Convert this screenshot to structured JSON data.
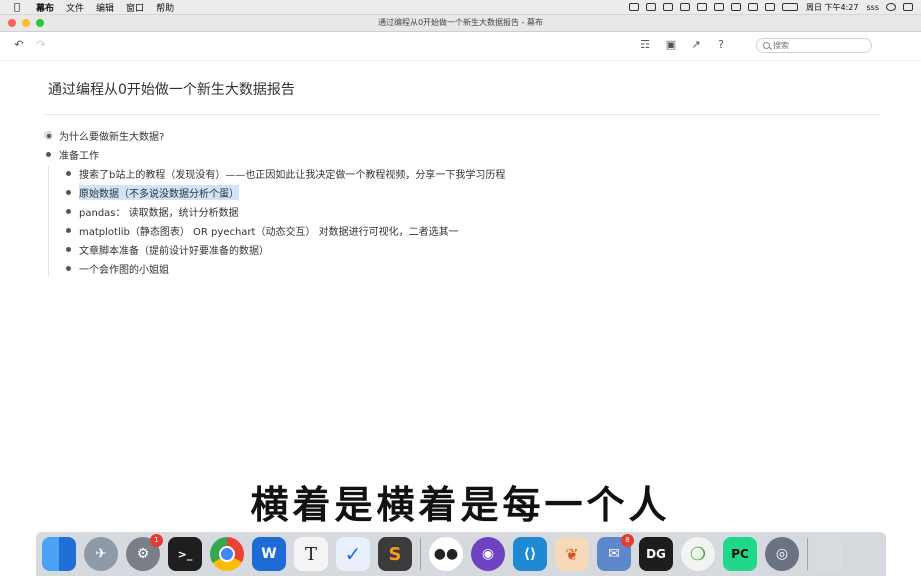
{
  "menubar": {
    "app_name": "幕布",
    "items": [
      "文件",
      "编辑",
      "窗口",
      "帮助"
    ],
    "clock": "周日 下午4:27",
    "user": "sss"
  },
  "window": {
    "title": "通过编程从0开始做一个新生大数据报告 - 幕布"
  },
  "toolbar": {
    "search_placeholder": "搜索"
  },
  "document": {
    "title": "通过编程从0开始做一个新生大数据报告",
    "outline": [
      {
        "text": "为什么要做新生大数据?",
        "collapsed": true
      },
      {
        "text": "准备工作",
        "children": [
          {
            "text": "搜索了b站上的教程（发现没有）——也正因如此让我决定做一个教程视频，分享一下我学习历程"
          },
          {
            "text": "原始数据（不多说没数据分析个蛋）",
            "highlighted": true
          },
          {
            "text": "pandas：  读取数据，统计分析数据"
          },
          {
            "text": "matplotlib（静态图表） OR pyechart（动态交互） 对数据进行可视化，二者选其一"
          },
          {
            "text": "文章脚本准备（提前设计好要准备的数据）"
          },
          {
            "text": "一个会作图的小姐姐"
          }
        ]
      }
    ]
  },
  "subtitle": "横着是横着是每一个人",
  "dock": {
    "badges": {
      "system-preferences": "1",
      "preview": "8"
    },
    "apps": [
      {
        "id": "finder",
        "label": "",
        "color": "#2f8ef0"
      },
      {
        "id": "launchpad",
        "label": "",
        "color": "#8e9aa8"
      },
      {
        "id": "system-preferences",
        "label": "",
        "color": "#7a7f87"
      },
      {
        "id": "terminal",
        "label": ">_",
        "color": "#1e1e1e"
      },
      {
        "id": "chrome",
        "label": "",
        "color": "#ffffff"
      },
      {
        "id": "wps",
        "label": "W",
        "color": "#1e6bd6"
      },
      {
        "id": "typora",
        "label": "T",
        "color": "#f4f4f4"
      },
      {
        "id": "todo",
        "label": "✓",
        "color": "#e9f0fb"
      },
      {
        "id": "sublime",
        "label": "S",
        "color": "#3b3b3b"
      },
      {
        "id": "mubu",
        "label": "",
        "color": "#ffffff"
      },
      {
        "id": "github",
        "label": "",
        "color": "#6f42c1"
      },
      {
        "id": "vscode",
        "label": "",
        "color": "#1f8ad2"
      },
      {
        "id": "butterfly",
        "label": "",
        "color": "#f6d9b8"
      },
      {
        "id": "preview",
        "label": "",
        "color": "#5d87c8"
      },
      {
        "id": "datagrip",
        "label": "DG",
        "color": "#1d1d1d"
      },
      {
        "id": "anaconda",
        "label": "",
        "color": "#f3f3f3"
      },
      {
        "id": "pycharm",
        "label": "PC",
        "color": "#21d789"
      },
      {
        "id": "dvd-player",
        "label": "",
        "color": "#6b7382"
      },
      {
        "id": "trash",
        "label": "",
        "color": "#d9dde2"
      }
    ]
  }
}
